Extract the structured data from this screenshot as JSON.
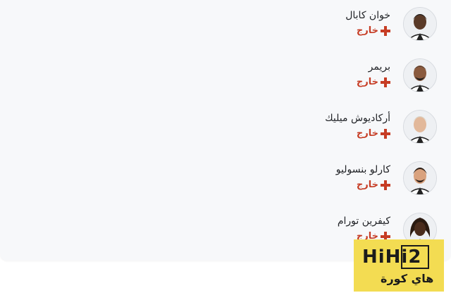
{
  "players": [
    {
      "name": "خوان كابال",
      "status": "خارج",
      "skin": "#5a3a28",
      "hair": "#1a1a1a"
    },
    {
      "name": "بريمر",
      "status": "خارج",
      "skin": "#8a5a3e",
      "hair": "#1d1d1d"
    },
    {
      "name": "أركاديوش ميليك",
      "status": "خارج",
      "skin": "#e2b89a",
      "hair": "#d9d4c8"
    },
    {
      "name": "كارلو بنسوليو",
      "status": "خارج",
      "skin": "#d9a27e",
      "hair": "#2a1c14"
    },
    {
      "name": "كيفرين تورام",
      "status": "خارج",
      "skin": "#4a2c1c",
      "hair": "#2a1a10"
    }
  ],
  "watermark": {
    "latin": "HiHi2",
    "arabic": "هاي كورة"
  },
  "colors": {
    "status": "#c63c24",
    "card_bg": "#f7f8fa",
    "watermark_bg": "#f3dc52"
  }
}
